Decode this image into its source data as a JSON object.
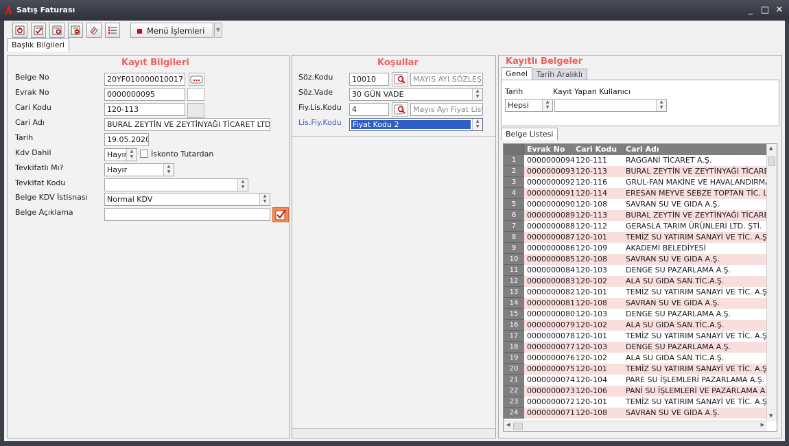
{
  "window": {
    "title": "Satış Faturası",
    "minimize": "_",
    "maximize": "□",
    "close": "✕"
  },
  "toolbar": {
    "buttons": [
      "power-icon",
      "check-list-icon",
      "add-record-icon",
      "remove-record-icon",
      "eraser-icon",
      "list-icon"
    ],
    "menu_label": "Menü İşlemleri"
  },
  "tabs": {
    "main": "Başlık Bilgileri"
  },
  "kayit": {
    "title": "Kayıt Bilgileri",
    "belge_no": {
      "label": "Belge No",
      "value": "20YF010000010017"
    },
    "evrak_no": {
      "label": "Evrak No",
      "value": "0000000095"
    },
    "cari_kodu": {
      "label": "Cari Kodu",
      "value": "120-113"
    },
    "cari_adi": {
      "label": "Cari Adı",
      "value": "BURAL ZEYTİN VE ZEYTİNYAĞI TİCARET LTD. ŞTİ"
    },
    "tarih": {
      "label": "Tarih",
      "value": "19.05.2020"
    },
    "kdv_dahil": {
      "label": "Kdv Dahil",
      "value": "Hayır"
    },
    "iskonto_tutardan": {
      "label": "İskonto Tutardan"
    },
    "tevkifatli": {
      "label": "Tevkifatlı Mı?",
      "value": "Hayır"
    },
    "tevkifat_kodu": {
      "label": "Tevkifat Kodu",
      "value": ""
    },
    "belge_kdv": {
      "label": "Belge KDV İstisnası",
      "value": "Normal KDV"
    },
    "belge_aciklama": {
      "label": "Belge Açıklama",
      "value": ""
    }
  },
  "kosullar": {
    "title": "Koşullar",
    "soz_kodu": {
      "label": "Söz.Kodu",
      "value": "10010",
      "desc": "MAYIS AYI SÖZLEŞM"
    },
    "soz_vade": {
      "label": "Söz.Vade",
      "value": "30 GÜN VADE"
    },
    "fiy_lis_kodu": {
      "label": "Fiy.Lis.Kodu",
      "value": "4",
      "desc": "Mayıs Ayı Fiyat Liste"
    },
    "lis_fiy_kodu": {
      "label": "Lis.Fiy.Kodu",
      "value": "Fiyat Kodu 2"
    }
  },
  "kayitli": {
    "title": "Kayıtlı Belgeler",
    "tabs": [
      "Genel",
      "Tarih Aralıklı"
    ],
    "tarih_label": "Tarih",
    "tarih_value": "Hepsi",
    "kullanici_label": "Kayıt Yapan Kullanıcı",
    "kullanici_value": "",
    "list_tab": "Belge Listesi",
    "columns": [
      "Evrak No",
      "Cari Kodu",
      "Cari Adı"
    ],
    "rows": [
      [
        "1",
        "0000000094",
        "120-111",
        "RAGGANİ TİCARET A.Ş."
      ],
      [
        "2",
        "0000000093",
        "120-113",
        "BURAL ZEYTİN VE ZEYTİNYAĞI TİCARET L"
      ],
      [
        "3",
        "0000000092",
        "120-116",
        "GRUL-FAN MAKİNE VE HAVALANDIRMA S"
      ],
      [
        "4",
        "0000000091",
        "120-114",
        "ERESAN MEYVE SEBZE TOPTAN TİC. LTD."
      ],
      [
        "5",
        "0000000090",
        "120-108",
        "SAVRAN SU VE GIDA A.Ş."
      ],
      [
        "6",
        "0000000089",
        "120-113",
        "BURAL ZEYTİN VE ZEYTİNYAĞI TİCARET L"
      ],
      [
        "7",
        "0000000088",
        "120-112",
        "GERASLA TARIM ÜRÜNLERİ LTD. ŞTİ."
      ],
      [
        "8",
        "0000000087",
        "120-101",
        "TEMİZ SU YATIRIM SANAYİ VE TİC. A.Ş."
      ],
      [
        "9",
        "0000000086",
        "120-109",
        "AKADEMİ BELEDİYESİ"
      ],
      [
        "10",
        "0000000085",
        "120-108",
        "SAVRAN SU VE GIDA A.Ş."
      ],
      [
        "11",
        "0000000084",
        "120-103",
        "DENGE SU PAZARLAMA A.Ş."
      ],
      [
        "12",
        "0000000083",
        "120-102",
        "ALA SU GIDA SAN.TİC.A.Ş."
      ],
      [
        "13",
        "0000000082",
        "120-101",
        "TEMİZ SU YATIRIM SANAYİ VE TİC. A.Ş."
      ],
      [
        "14",
        "0000000081",
        "120-108",
        "SAVRAN SU VE GIDA A.Ş."
      ],
      [
        "15",
        "0000000080",
        "120-103",
        "DENGE SU PAZARLAMA A.Ş."
      ],
      [
        "16",
        "0000000079",
        "120-102",
        "ALA SU GIDA SAN.TİC.A.Ş."
      ],
      [
        "17",
        "0000000078",
        "120-101",
        "TEMİZ SU YATIRIM SANAYİ VE TİC. A.Ş."
      ],
      [
        "18",
        "0000000077",
        "120-103",
        "DENGE SU PAZARLAMA A.Ş."
      ],
      [
        "19",
        "0000000076",
        "120-102",
        "ALA SU GIDA SAN.TİC.A.Ş."
      ],
      [
        "20",
        "0000000075",
        "120-101",
        "TEMİZ SU YATIRIM SANAYİ VE TİC. A.Ş."
      ],
      [
        "21",
        "0000000074",
        "120-104",
        "PARE SU İŞLEMLERİ PAZARLAMA A.Ş."
      ],
      [
        "22",
        "0000000073",
        "120-106",
        "PANİ SU İŞLEMLERİ VE PAZARLAMA A.Ş."
      ],
      [
        "23",
        "0000000072",
        "120-101",
        "TEMİZ SU YATIRIM SANAYİ VE TİC. A.Ş."
      ],
      [
        "24",
        "0000000071",
        "120-108",
        "SAVRAN SU VE GIDA A.Ş."
      ]
    ]
  }
}
